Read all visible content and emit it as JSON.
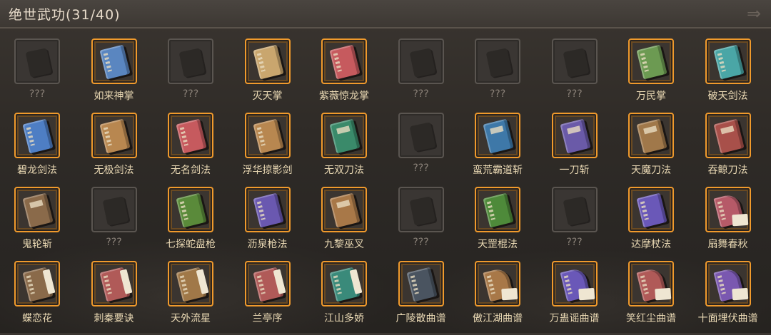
{
  "header": {
    "title": "绝世武功(31/40)",
    "close_icon": "close-arrow-icon"
  },
  "items": [
    {
      "label": "???",
      "locked": true
    },
    {
      "label": "如来神掌",
      "locked": false,
      "color": "#5a86c0",
      "style": "book"
    },
    {
      "label": "???",
      "locked": true
    },
    {
      "label": "灭天掌",
      "locked": false,
      "color": "#c9a66e",
      "style": "book"
    },
    {
      "label": "紫薇惊龙掌",
      "locked": false,
      "color": "#c65a5e",
      "style": "book"
    },
    {
      "label": "???",
      "locked": true
    },
    {
      "label": "???",
      "locked": true
    },
    {
      "label": "???",
      "locked": true
    },
    {
      "label": "万民掌",
      "locked": false,
      "color": "#6c9a52",
      "style": "book"
    },
    {
      "label": "破天剑法",
      "locked": false,
      "color": "#4aa6a6",
      "style": "book"
    },
    {
      "label": "碧龙剑法",
      "locked": false,
      "color": "#4e7ec4",
      "style": "book"
    },
    {
      "label": "无极剑法",
      "locked": false,
      "color": "#b88750",
      "style": "book"
    },
    {
      "label": "无名剑法",
      "locked": false,
      "color": "#c65a5e",
      "style": "book"
    },
    {
      "label": "浮华掠影剑",
      "locked": false,
      "color": "#b88750",
      "style": "book"
    },
    {
      "label": "无双刀法",
      "locked": false,
      "color": "#3a8a6a",
      "style": "scroll"
    },
    {
      "label": "???",
      "locked": true
    },
    {
      "label": "蛮荒霸道斩",
      "locked": false,
      "color": "#3e78a8",
      "style": "scroll"
    },
    {
      "label": "一刀斩",
      "locked": false,
      "color": "#6a5aa8",
      "style": "scroll"
    },
    {
      "label": "天魔刀法",
      "locked": false,
      "color": "#a0784a",
      "style": "scroll"
    },
    {
      "label": "吞鲸刀法",
      "locked": false,
      "color": "#a8504a",
      "style": "scroll"
    },
    {
      "label": "鬼轮斩",
      "locked": false,
      "color": "#8a6a4a",
      "style": "scroll"
    },
    {
      "label": "???",
      "locked": true
    },
    {
      "label": "七探蛇盘枪",
      "locked": false,
      "color": "#5a8a3a",
      "style": "book"
    },
    {
      "label": "沥泉枪法",
      "locked": false,
      "color": "#6a58b0",
      "style": "book"
    },
    {
      "label": "九黎巫叉",
      "locked": false,
      "color": "#a87848",
      "style": "scroll"
    },
    {
      "label": "???",
      "locked": true
    },
    {
      "label": "天罡棍法",
      "locked": false,
      "color": "#4e8a3a",
      "style": "book"
    },
    {
      "label": "???",
      "locked": true
    },
    {
      "label": "达摩杖法",
      "locked": false,
      "color": "#6a58b8",
      "style": "book"
    },
    {
      "label": "扇舞春秋",
      "locked": false,
      "color": "#b65a68",
      "style": "fan"
    },
    {
      "label": "蝶恋花",
      "locked": false,
      "color": "#8a6a4a",
      "style": "flip"
    },
    {
      "label": "刺秦要诀",
      "locked": false,
      "color": "#b05a58",
      "style": "flip"
    },
    {
      "label": "天外流星",
      "locked": false,
      "color": "#a07848",
      "style": "flip"
    },
    {
      "label": "兰亭序",
      "locked": false,
      "color": "#b05a58",
      "style": "flip"
    },
    {
      "label": "江山多娇",
      "locked": false,
      "color": "#3a8a7a",
      "style": "flip"
    },
    {
      "label": "广陵散曲谱",
      "locked": false,
      "color": "#4a5460",
      "style": "book"
    },
    {
      "label": "傲江湖曲谱",
      "locked": false,
      "color": "#a87848",
      "style": "fan"
    },
    {
      "label": "万蛊谣曲谱",
      "locked": false,
      "color": "#6a58b8",
      "style": "fan"
    },
    {
      "label": "笑红尘曲谱",
      "locked": false,
      "color": "#b05a58",
      "style": "fan"
    },
    {
      "label": "十面埋伏曲谱",
      "locked": false,
      "color": "#7a58b0",
      "style": "fan"
    }
  ]
}
